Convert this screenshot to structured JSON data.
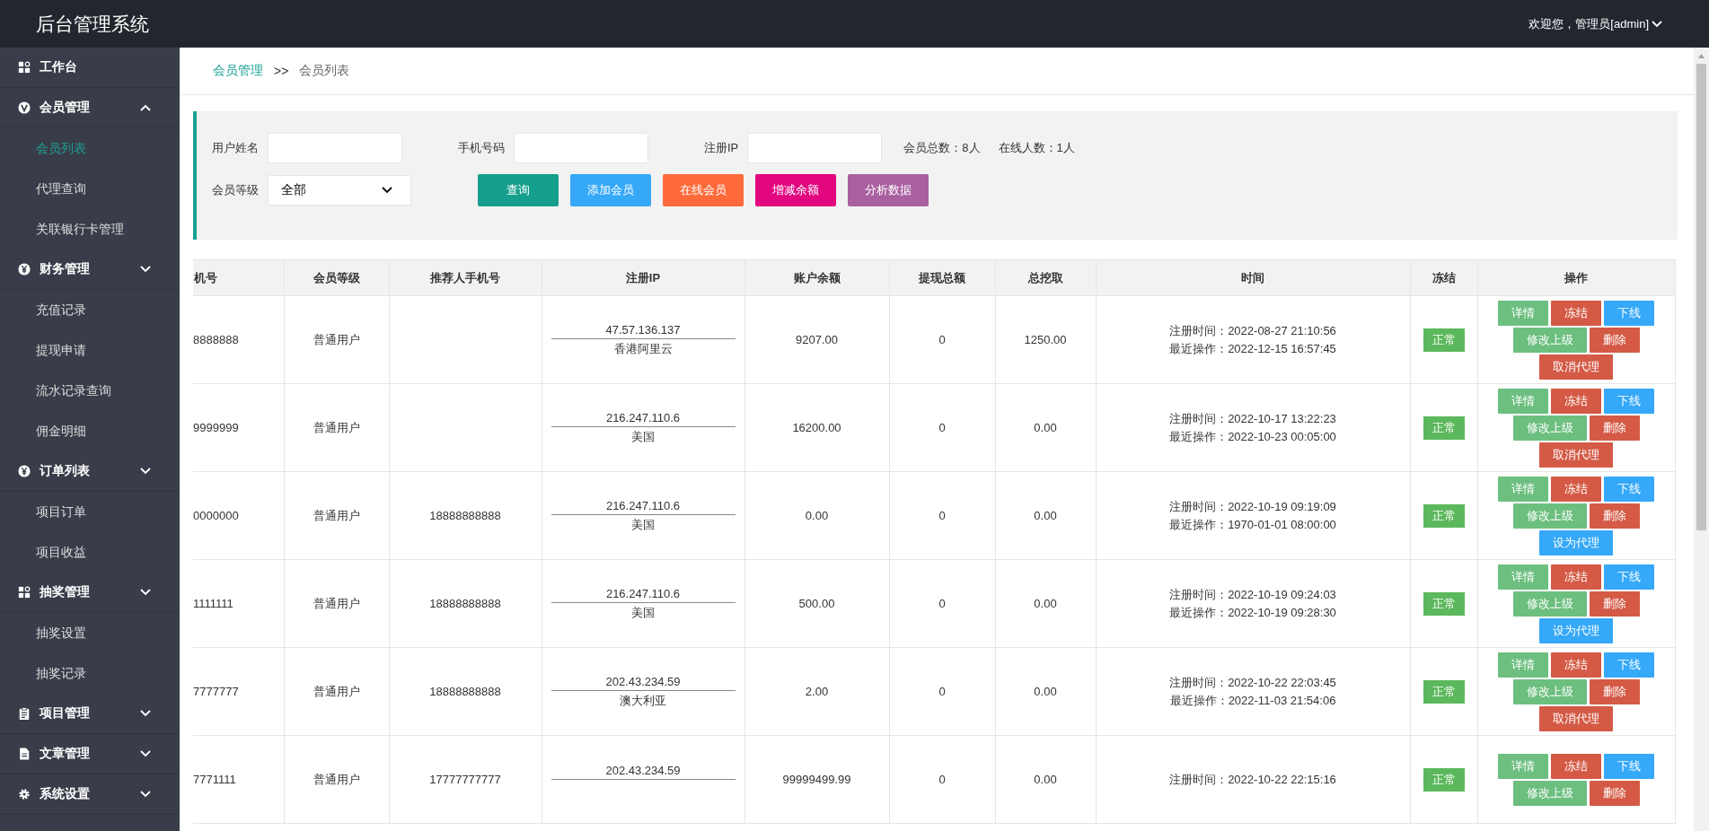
{
  "header": {
    "title": "后台管理系统",
    "user": "欢迎您，管理员[admin]"
  },
  "sidebar": {
    "items": [
      {
        "label": "工作台",
        "kind": "dashboard"
      },
      {
        "label": "会员管理",
        "kind": "member",
        "expanded": true,
        "children": [
          {
            "label": "会员列表",
            "selected": true
          },
          {
            "label": "代理查询",
            "selected": false
          },
          {
            "label": "关联银行卡管理",
            "selected": false
          }
        ]
      },
      {
        "label": "财务管理",
        "kind": "finance",
        "expanded": false,
        "children": [
          {
            "label": "充值记录",
            "selected": false
          },
          {
            "label": "提现申请",
            "selected": false
          },
          {
            "label": "流水记录查询",
            "selected": false
          },
          {
            "label": "佣金明细",
            "selected": false
          }
        ]
      },
      {
        "label": "订单列表",
        "kind": "order",
        "expanded": false,
        "children": [
          {
            "label": "项目订单",
            "selected": false
          },
          {
            "label": "项目收益",
            "selected": false
          }
        ]
      },
      {
        "label": "抽奖管理",
        "kind": "lottery",
        "expanded": false,
        "children": [
          {
            "label": "抽奖设置",
            "selected": false
          },
          {
            "label": "抽奖记录",
            "selected": false
          }
        ]
      },
      {
        "label": "项目管理",
        "kind": "project",
        "expanded": false
      },
      {
        "label": "文章管理",
        "kind": "article",
        "expanded": false
      },
      {
        "label": "系统设置",
        "kind": "settings",
        "expanded": false
      }
    ]
  },
  "breadcrumb": [
    "会员管理",
    ">>",
    "会员列表"
  ],
  "filters": {
    "fields": [
      {
        "label": "用户姓名"
      },
      {
        "label": "手机号码"
      },
      {
        "label": "注册IP"
      }
    ],
    "stats": [
      "会员总数：8人",
      "在线人数：1人"
    ],
    "level_select": {
      "label": "会员等级",
      "value": "全部"
    },
    "buttons": [
      {
        "label": "查询",
        "kind": "search"
      },
      {
        "label": "添加会员",
        "kind": "add"
      },
      {
        "label": "在线会员",
        "kind": "online"
      },
      {
        "label": "增减余额",
        "kind": "balance"
      },
      {
        "label": "分析数据",
        "kind": "analyze"
      }
    ]
  },
  "table": {
    "columns": [
      "机号",
      "会员等级",
      "推荐人手机号",
      "注册IP",
      "账户余额",
      "提现总额",
      "总挖取",
      "时间",
      "冻结",
      "操作"
    ],
    "rows": [
      {
        "phone": "8888888",
        "level": "普通用户",
        "referrer": "",
        "ip": "47.57.136.137",
        "location": "香港阿里云",
        "balance": "9207.00",
        "withdrawn": "0",
        "mined": "1250.00",
        "times": [
          "注册时间：2022-08-27 21:10:56",
          "最近操作：2022-12-15 16:57:45"
        ],
        "status": {
          "label": "正常",
          "frozen": false
        },
        "actions": [
          {
            "label": "详情",
            "kind": "detail"
          },
          {
            "label": "冻结",
            "kind": "freeze"
          },
          {
            "label": "下线",
            "kind": "offline"
          },
          {
            "label": "修改上级",
            "kind": "edit"
          },
          {
            "label": "删除",
            "kind": "delete"
          },
          {
            "label": "取消代理",
            "kind": "revoke"
          }
        ]
      },
      {
        "phone": "9999999",
        "level": "普通用户",
        "referrer": "",
        "ip": "216.247.110.6",
        "location": "美国",
        "balance": "16200.00",
        "withdrawn": "0",
        "mined": "0.00",
        "times": [
          "注册时间：2022-10-17 13:22:23",
          "最近操作：2022-10-23 00:05:00"
        ],
        "status": {
          "label": "正常",
          "frozen": false
        },
        "actions": [
          {
            "label": "详情",
            "kind": "detail"
          },
          {
            "label": "冻结",
            "kind": "freeze"
          },
          {
            "label": "下线",
            "kind": "offline"
          },
          {
            "label": "修改上级",
            "kind": "edit"
          },
          {
            "label": "删除",
            "kind": "delete"
          },
          {
            "label": "取消代理",
            "kind": "revoke"
          }
        ]
      },
      {
        "phone": "0000000",
        "level": "普通用户",
        "referrer": "18888888888",
        "ip": "216.247.110.6",
        "location": "美国",
        "balance": "0.00",
        "withdrawn": "0",
        "mined": "0.00",
        "times": [
          "注册时间：2022-10-19 09:19:09",
          "最近操作：1970-01-01 08:00:00"
        ],
        "status": {
          "label": "正常",
          "frozen": false
        },
        "actions": [
          {
            "label": "详情",
            "kind": "detail"
          },
          {
            "label": "冻结",
            "kind": "freeze"
          },
          {
            "label": "下线",
            "kind": "offline"
          },
          {
            "label": "修改上级",
            "kind": "edit"
          },
          {
            "label": "删除",
            "kind": "delete"
          },
          {
            "label": "设为代理",
            "kind": "assign"
          }
        ]
      },
      {
        "phone": "1111111",
        "level": "普通用户",
        "referrer": "18888888888",
        "ip": "216.247.110.6",
        "location": "美国",
        "balance": "500.00",
        "withdrawn": "0",
        "mined": "0.00",
        "times": [
          "注册时间：2022-10-19 09:24:03",
          "最近操作：2022-10-19 09:28:30"
        ],
        "status": {
          "label": "正常",
          "frozen": false
        },
        "actions": [
          {
            "label": "详情",
            "kind": "detail"
          },
          {
            "label": "冻结",
            "kind": "freeze"
          },
          {
            "label": "下线",
            "kind": "offline"
          },
          {
            "label": "修改上级",
            "kind": "edit"
          },
          {
            "label": "删除",
            "kind": "delete"
          },
          {
            "label": "设为代理",
            "kind": "assign"
          }
        ]
      },
      {
        "phone": "7777777",
        "level": "普通用户",
        "referrer": "18888888888",
        "ip": "202.43.234.59",
        "location": "澳大利亚",
        "balance": "2.00",
        "withdrawn": "0",
        "mined": "0.00",
        "times": [
          "注册时间：2022-10-22 22:03:45",
          "最近操作：2022-11-03 21:54:06"
        ],
        "status": {
          "label": "正常",
          "frozen": false
        },
        "actions": [
          {
            "label": "详情",
            "kind": "detail"
          },
          {
            "label": "冻结",
            "kind": "freeze"
          },
          {
            "label": "下线",
            "kind": "offline"
          },
          {
            "label": "修改上级",
            "kind": "edit"
          },
          {
            "label": "删除",
            "kind": "delete"
          },
          {
            "label": "取消代理",
            "kind": "revoke"
          }
        ]
      },
      {
        "phone": "7771111",
        "level": "普通用户",
        "referrer": "17777777777",
        "ip": "202.43.234.59",
        "balance": "99999499.99",
        "withdrawn": "0",
        "mined": "0.00",
        "times": [
          "注册时间：2022-10-22 22:15:16"
        ],
        "status": {
          "label": "正常",
          "frozen": false
        },
        "actions": [
          {
            "label": "详情",
            "kind": "detail"
          },
          {
            "label": "冻结",
            "kind": "freeze"
          },
          {
            "label": "下线",
            "kind": "offline"
          },
          {
            "label": "修改上级",
            "kind": "edit"
          },
          {
            "label": "删除",
            "kind": "delete"
          }
        ]
      }
    ]
  }
}
